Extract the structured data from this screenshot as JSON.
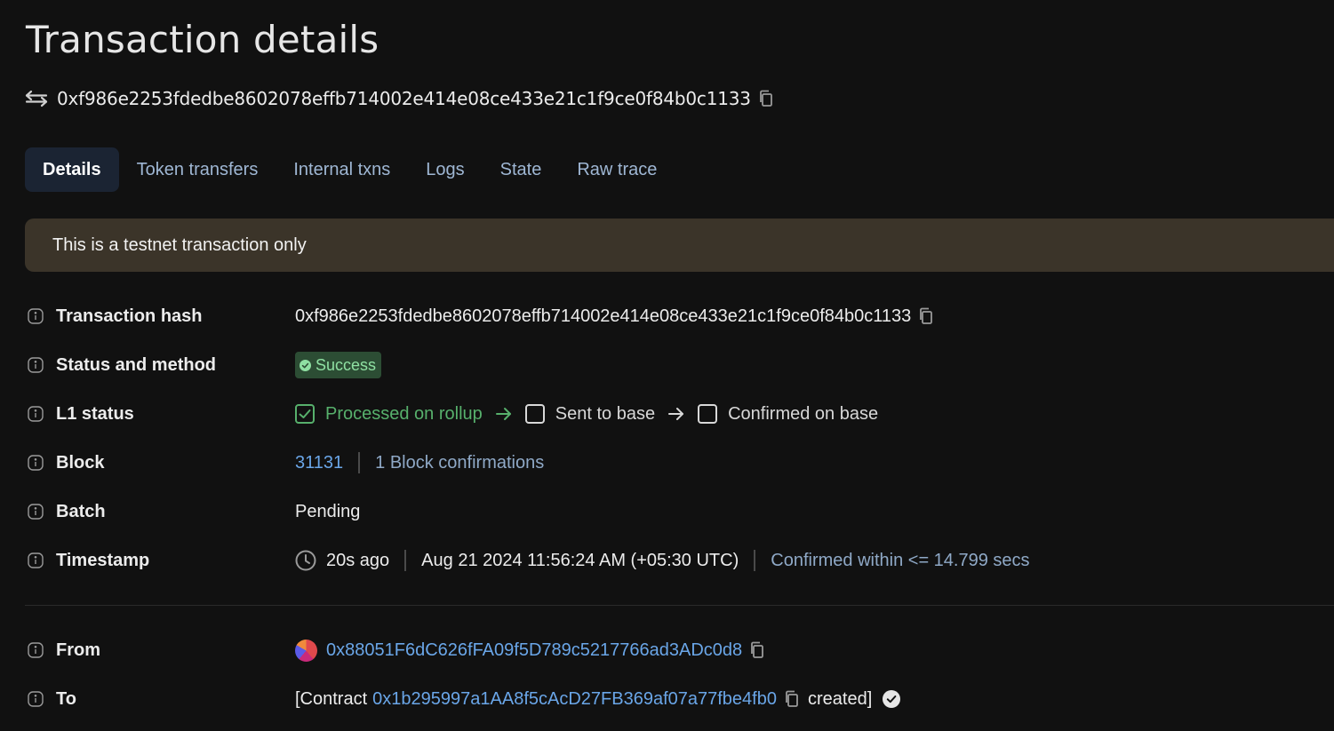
{
  "page": {
    "title": "Transaction details",
    "hash": "0xf986e2253fdedbe8602078effb714002e414e08ce433e21c1f9ce0f84b0c1133"
  },
  "tabs": [
    {
      "label": "Details",
      "active": true
    },
    {
      "label": "Token transfers",
      "active": false
    },
    {
      "label": "Internal txns",
      "active": false
    },
    {
      "label": "Logs",
      "active": false
    },
    {
      "label": "State",
      "active": false
    },
    {
      "label": "Raw trace",
      "active": false
    }
  ],
  "banner": {
    "text": "This is a testnet transaction only"
  },
  "details": {
    "tx_hash": {
      "label": "Transaction hash",
      "value": "0xf986e2253fdedbe8602078effb714002e414e08ce433e21c1f9ce0f84b0c1133"
    },
    "status": {
      "label": "Status and method",
      "value": "Success"
    },
    "l1_status": {
      "label": "L1 status",
      "steps": [
        "Processed on rollup",
        "Sent to base",
        "Confirmed on base"
      ]
    },
    "block": {
      "label": "Block",
      "number": "31131",
      "confirmations": "1 Block confirmations"
    },
    "batch": {
      "label": "Batch",
      "value": "Pending"
    },
    "timestamp": {
      "label": "Timestamp",
      "relative": "20s ago",
      "absolute": "Aug 21 2024 11:56:24 AM (+05:30 UTC)",
      "confirmed": "Confirmed within <= 14.799 secs"
    },
    "from": {
      "label": "From",
      "address": "0x88051F6dC626fFA09f5D789c5217766ad3ADc0d8"
    },
    "to": {
      "label": "To",
      "prefix": "[Contract",
      "address": "0x1b295997a1AA8f5cAcD27FB369af07a77fbe4fb0",
      "suffix": "created]"
    }
  },
  "colors": {
    "background": "#111111",
    "link": "#6aa6e8",
    "success_bg": "#2c4d34",
    "success_text": "#8fe0a2",
    "banner_bg": "#3b3429",
    "active_tab_bg": "#1b2433"
  },
  "icons": [
    "swap-arrows-icon",
    "copy-icon",
    "info-icon",
    "check-circle-icon",
    "checkbox-icon",
    "arrow-right-icon",
    "clock-icon",
    "avatar-icon",
    "verified-icon"
  ]
}
